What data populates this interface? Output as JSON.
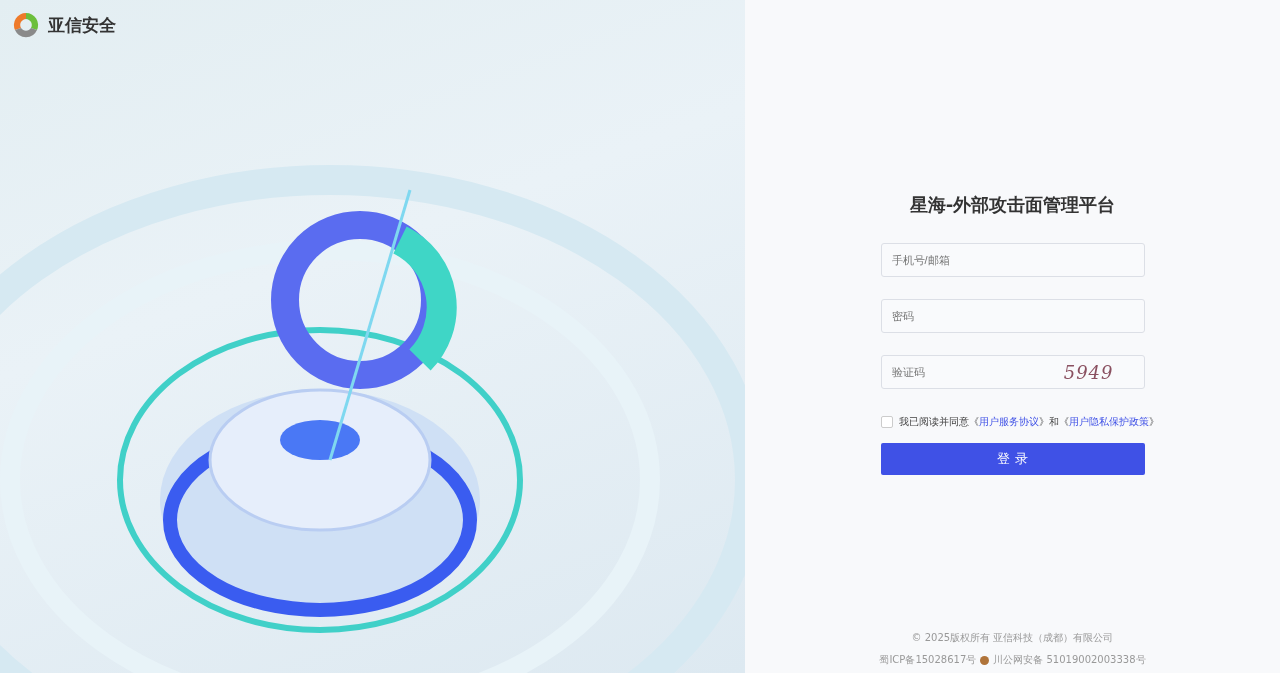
{
  "brand": {
    "name": "亚信安全"
  },
  "login": {
    "title": "星海-外部攻击面管理平台",
    "fields": [
      {
        "kind": "text",
        "placeholder": "手机号/邮箱"
      },
      {
        "kind": "password",
        "placeholder": "密码"
      },
      {
        "kind": "captcha",
        "placeholder": "验证码",
        "captcha": "5949"
      }
    ],
    "agreement": {
      "checked": false,
      "parts": [
        {
          "kind": "text",
          "text": "我已阅读并同意《"
        },
        {
          "kind": "link",
          "text": "用户服务协议"
        },
        {
          "kind": "text",
          "text": "》和《"
        },
        {
          "kind": "link",
          "text": "用户隐私保护政策"
        },
        {
          "kind": "text",
          "text": "》"
        }
      ]
    },
    "submit": "登 录"
  },
  "footer": {
    "copyright": "© 2025版权所有 亚信科技（成都）有限公司",
    "icp": "蜀ICP备15028617号",
    "police": "川公网安备 51019002003338号"
  }
}
